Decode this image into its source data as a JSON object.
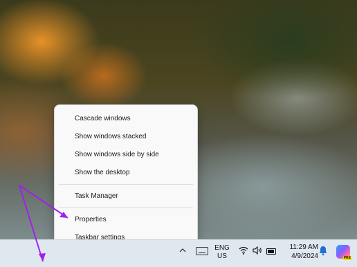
{
  "context_menu": {
    "items": [
      {
        "label": "Cascade windows"
      },
      {
        "label": "Show windows stacked"
      },
      {
        "label": "Show windows side by side"
      },
      {
        "label": "Show the desktop"
      },
      {
        "label": "Task Manager"
      },
      {
        "label": "Properties"
      },
      {
        "label": "Taskbar settings"
      }
    ]
  },
  "taskbar": {
    "language_line1": "ENG",
    "language_line2": "US",
    "time": "11:29 AM",
    "date": "4/9/2024",
    "copilot_badge": "PRE",
    "icons": [
      "chevron-up-icon",
      "keyboard-icon",
      "wifi-icon",
      "volume-icon",
      "battery-icon",
      "bell-icon",
      "copilot-icon"
    ]
  },
  "colors": {
    "annotation_arrow": "#a020f0",
    "taskbar_bg": "#dfe8ef",
    "notification_bell": "#1f6fd6"
  }
}
